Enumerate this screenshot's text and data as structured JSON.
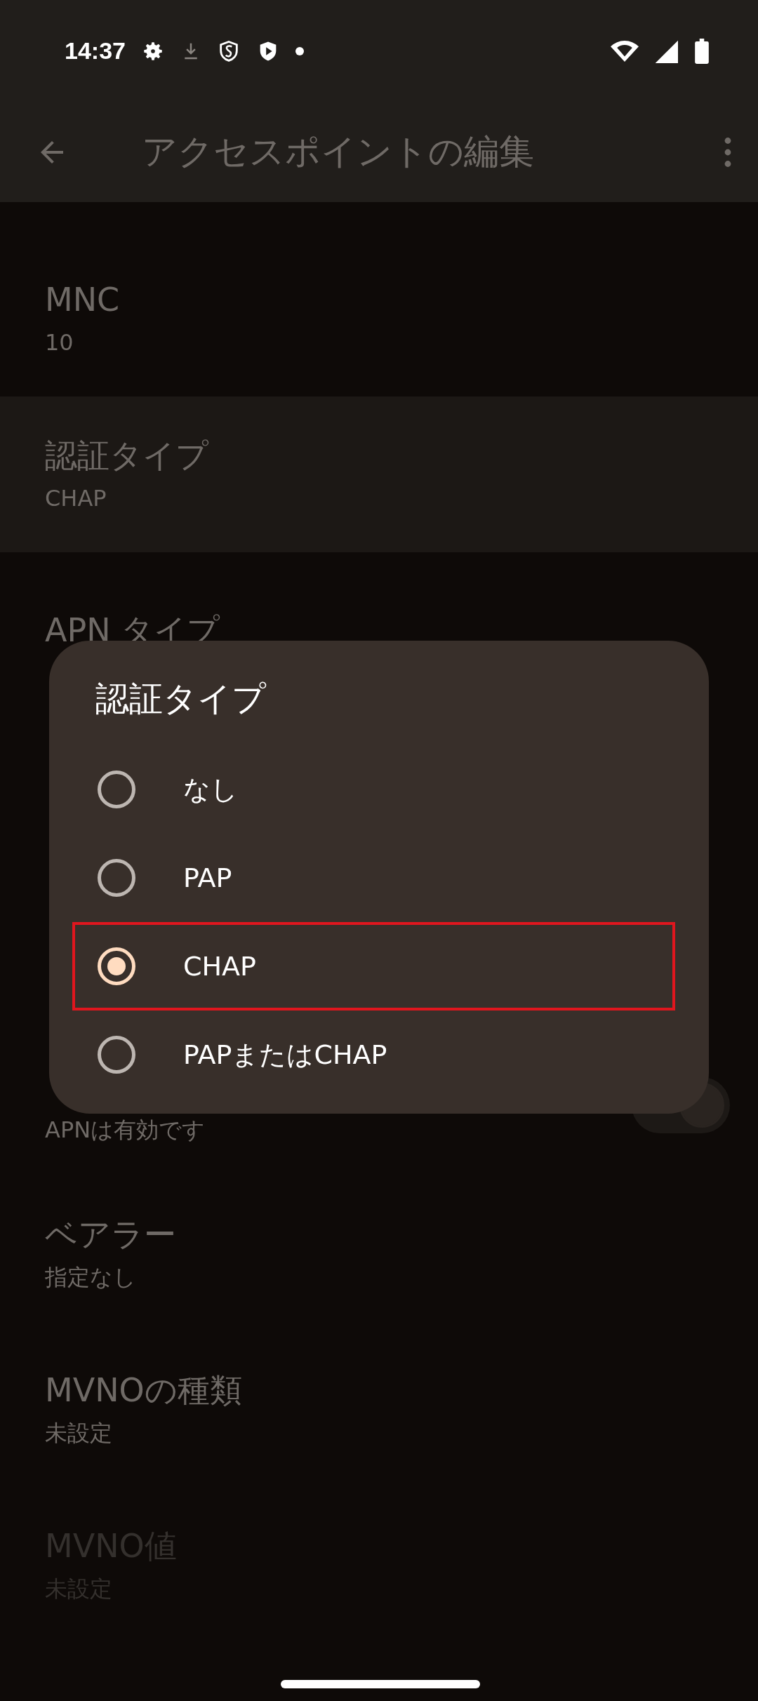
{
  "status_bar": {
    "time": "14:37"
  },
  "app_bar": {
    "title": "アクセスポイントの編集"
  },
  "settings": [
    {
      "title": "MNC",
      "value": "10",
      "highlighted": false,
      "disabled": false
    },
    {
      "title": "認証タイプ",
      "value": "CHAP",
      "highlighted": true,
      "disabled": false
    },
    {
      "title": "APN タイプ",
      "highlighted": false,
      "disabled": false
    },
    {
      "highlighted": false
    },
    {
      "highlighted": false
    },
    {
      "value": "APNは有効です",
      "highlighted": false,
      "disabled": false,
      "kind": "toggle",
      "on": true
    },
    {
      "title": "ベアラー",
      "value": "指定なし",
      "highlighted": false,
      "disabled": false
    },
    {
      "title": "MVNOの種類",
      "value": "未設定",
      "highlighted": false,
      "disabled": false
    },
    {
      "title": "MVNO値",
      "value": "未設定",
      "highlighted": false,
      "disabled": true
    }
  ],
  "dialog": {
    "title": "認証タイプ",
    "options": [
      {
        "label": "なし",
        "selected": false,
        "highlighted": false
      },
      {
        "label": "PAP",
        "selected": false,
        "highlighted": false
      },
      {
        "label": "CHAP",
        "selected": true,
        "highlighted": true
      },
      {
        "label": "PAPまたはCHAP",
        "selected": false,
        "highlighted": false
      }
    ]
  }
}
